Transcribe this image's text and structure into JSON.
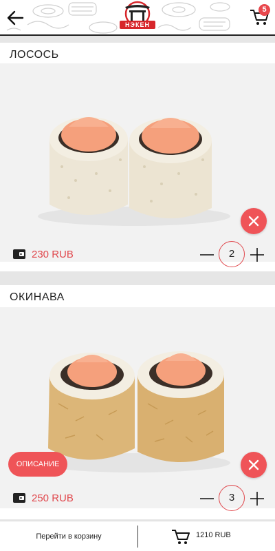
{
  "header": {
    "logo_text": "НЭКЕН",
    "cart_count": "5"
  },
  "products": [
    {
      "title": "ЛОСОСЬ",
      "price": "230 RUB",
      "quantity": "2"
    },
    {
      "title": "ОКИНАВА",
      "price": "250 RUB",
      "quantity": "3",
      "description_label": "ОПИСАНИЕ"
    }
  ],
  "bottom_bar": {
    "goto_cart_label": "Перейти в корзину",
    "total": "1210 RUB"
  },
  "colors": {
    "accent": "#ef5458",
    "price": "#e0474c",
    "header_line": "#222222"
  },
  "icons": [
    "back-arrow-icon",
    "logo",
    "cart-icon",
    "close-icon",
    "wallet-icon",
    "minus-icon",
    "plus-icon"
  ]
}
